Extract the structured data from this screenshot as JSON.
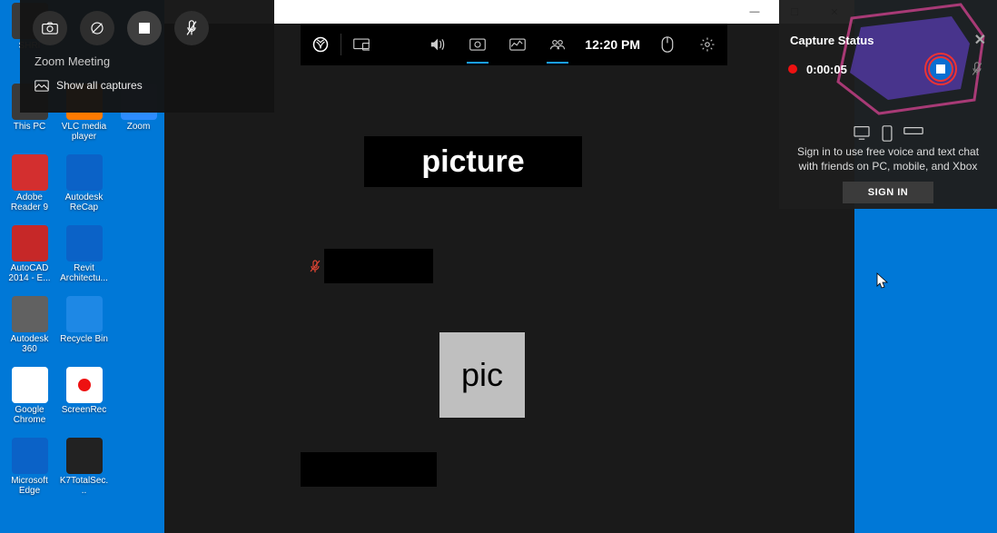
{
  "desktop": {
    "icons": [
      {
        "label": "SHRI",
        "color": "#f7c948"
      },
      {
        "label": "This PC",
        "color": "#3a3a3a"
      },
      {
        "label": "VLC media player",
        "color": "#ff7a00"
      },
      {
        "label": "Zoom",
        "color": "#2d8cff"
      },
      {
        "label": "Adobe Reader 9",
        "color": "#d32f2f"
      },
      {
        "label": "Autodesk ReCap",
        "color": "#0b62c7"
      },
      {
        "label": "AutoCAD 2014 - E...",
        "color": "#c62828"
      },
      {
        "label": "Revit Architectu...",
        "color": "#0b62c7"
      },
      {
        "label": "Autodesk 360",
        "color": "#616161"
      },
      {
        "label": "Recycle Bin",
        "color": "#1e88e5"
      },
      {
        "label": "Google Chrome",
        "color": "#ffffff"
      },
      {
        "label": "ScreenRec",
        "color": "#ffffff"
      },
      {
        "label": "Microsoft Edge",
        "color": "#0b62c7"
      },
      {
        "label": "K7TotalSec...",
        "color": "#222"
      }
    ]
  },
  "capture_widget": {
    "app_label": "Zoom Meeting",
    "show_all": "Show all captures"
  },
  "gamebar": {
    "time": "12:20 PM"
  },
  "zoom": {
    "main_label": "picture",
    "pic_label": "pic"
  },
  "xbox": {
    "title": "Capture Status",
    "rec_time": "0:00:05",
    "promo_line": "Sign in to use free voice and text chat with friends on PC, mobile, and Xbox",
    "signin": "SIGN IN"
  }
}
